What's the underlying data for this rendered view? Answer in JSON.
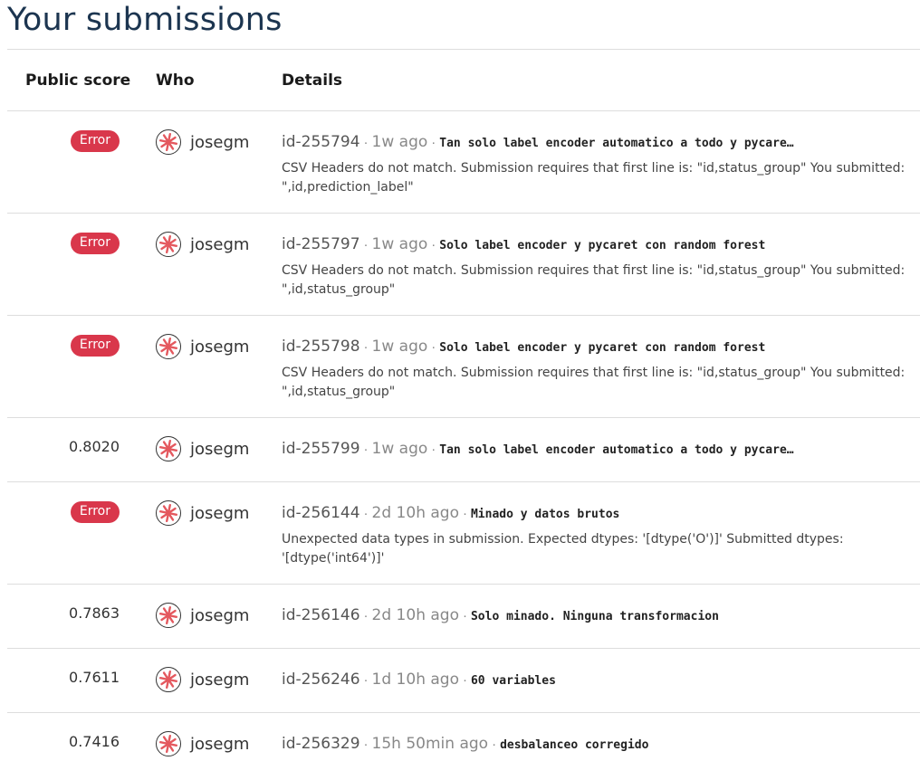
{
  "page": {
    "title": "Your submissions"
  },
  "table": {
    "headers": {
      "score": "Public score",
      "who": "Who",
      "details": "Details"
    },
    "rows": [
      {
        "score_type": "error",
        "score": "Error",
        "who": "josegm",
        "id": "id-255794",
        "time": "1w ago",
        "description": "Tan solo label encoder automatico a todo y pycare…",
        "message": "CSV Headers do not match. Submission requires that first line is: \"id,status_group\" You submitted: \",id,prediction_label\""
      },
      {
        "score_type": "error",
        "score": "Error",
        "who": "josegm",
        "id": "id-255797",
        "time": "1w ago",
        "description": "Solo label encoder y pycaret con random forest",
        "message": "CSV Headers do not match. Submission requires that first line is: \"id,status_group\" You submitted: \",id,status_group\""
      },
      {
        "score_type": "error",
        "score": "Error",
        "who": "josegm",
        "id": "id-255798",
        "time": "1w ago",
        "description": "Solo label encoder y pycaret con random forest",
        "message": "CSV Headers do not match. Submission requires that first line is: \"id,status_group\" You submitted: \",id,status_group\""
      },
      {
        "score_type": "value",
        "score": "0.8020",
        "who": "josegm",
        "id": "id-255799",
        "time": "1w ago",
        "description": "Tan solo label encoder automatico a todo y pycare…",
        "message": ""
      },
      {
        "score_type": "error",
        "score": "Error",
        "who": "josegm",
        "id": "id-256144",
        "time": "2d 10h ago",
        "description": "Minado y datos brutos",
        "message": "Unexpected data types in submission. Expected dtypes: '[dtype('O')]' Submitted dtypes: '[dtype('int64')]'"
      },
      {
        "score_type": "value",
        "score": "0.7863",
        "who": "josegm",
        "id": "id-256146",
        "time": "2d 10h ago",
        "description": "Solo minado. Ninguna transformacion",
        "message": ""
      },
      {
        "score_type": "value",
        "score": "0.7611",
        "who": "josegm",
        "id": "id-256246",
        "time": "1d 10h ago",
        "description": "60 variables",
        "message": ""
      },
      {
        "score_type": "value",
        "score": "0.7416",
        "who": "josegm",
        "id": "id-256329",
        "time": "15h 50min ago",
        "description": "desbalanceo corregido",
        "message": ""
      }
    ]
  },
  "colors": {
    "title": "#1c3550",
    "error_badge": "#d9374b",
    "divider": "#dddddd",
    "avatar_accent": "#e4585e"
  },
  "icons": {
    "avatar": "user-avatar-icon"
  }
}
